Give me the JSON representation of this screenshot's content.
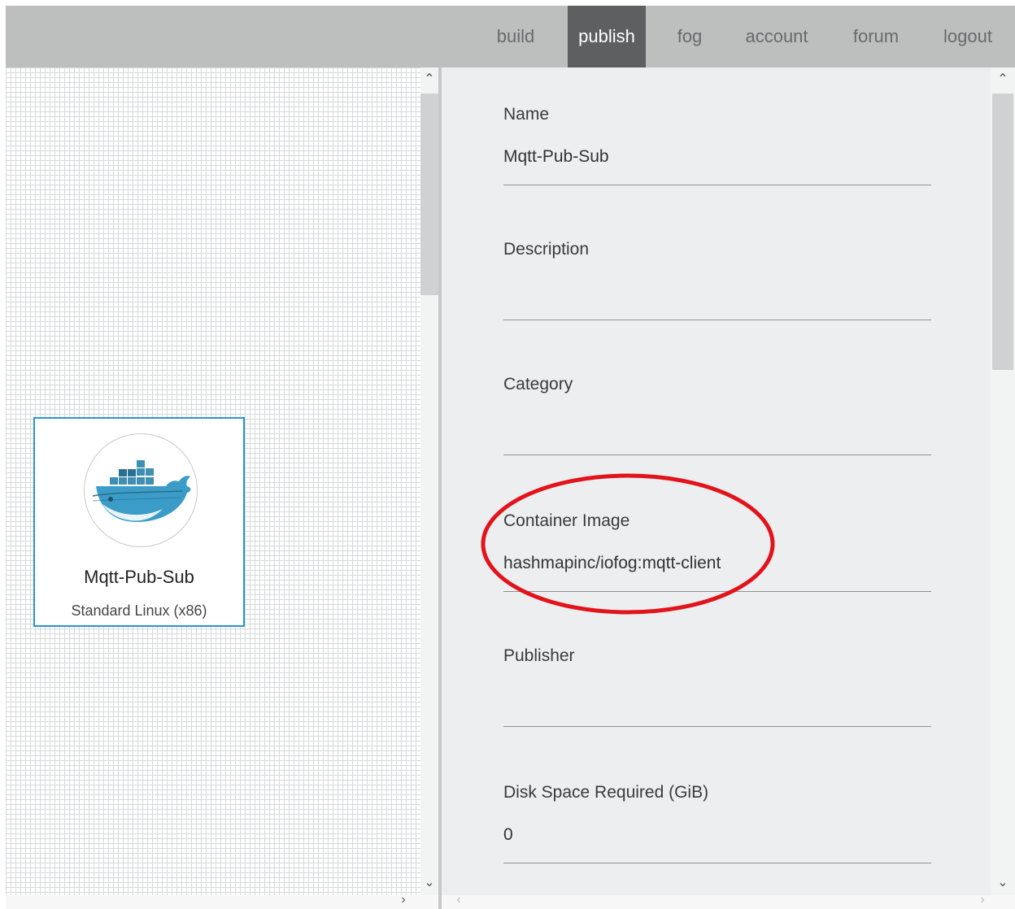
{
  "nav": {
    "items": [
      {
        "label": "build"
      },
      {
        "label": "publish"
      },
      {
        "label": "fog"
      },
      {
        "label": "account"
      },
      {
        "label": "forum"
      },
      {
        "label": "logout"
      }
    ],
    "active": "publish"
  },
  "node": {
    "title": "Mqtt-Pub-Sub",
    "platform": "Standard Linux (x86)",
    "icon": "docker-whale-icon"
  },
  "form": {
    "fields": [
      {
        "label": "Name",
        "value": "Mqtt-Pub-Sub"
      },
      {
        "label": "Description",
        "value": ""
      },
      {
        "label": "Category",
        "value": ""
      },
      {
        "label": "Container Image",
        "value": "hashmapinc/iofog:mqtt-client"
      },
      {
        "label": "Publisher",
        "value": ""
      },
      {
        "label": "Disk Space Required (GiB)",
        "value": "0"
      }
    ]
  },
  "colors": {
    "nav_bg": "#bdbebe",
    "nav_active": "#5d5f60",
    "card_border": "#2a93d5",
    "annotation": "#e3131b",
    "panel_bg": "#eceef0"
  }
}
